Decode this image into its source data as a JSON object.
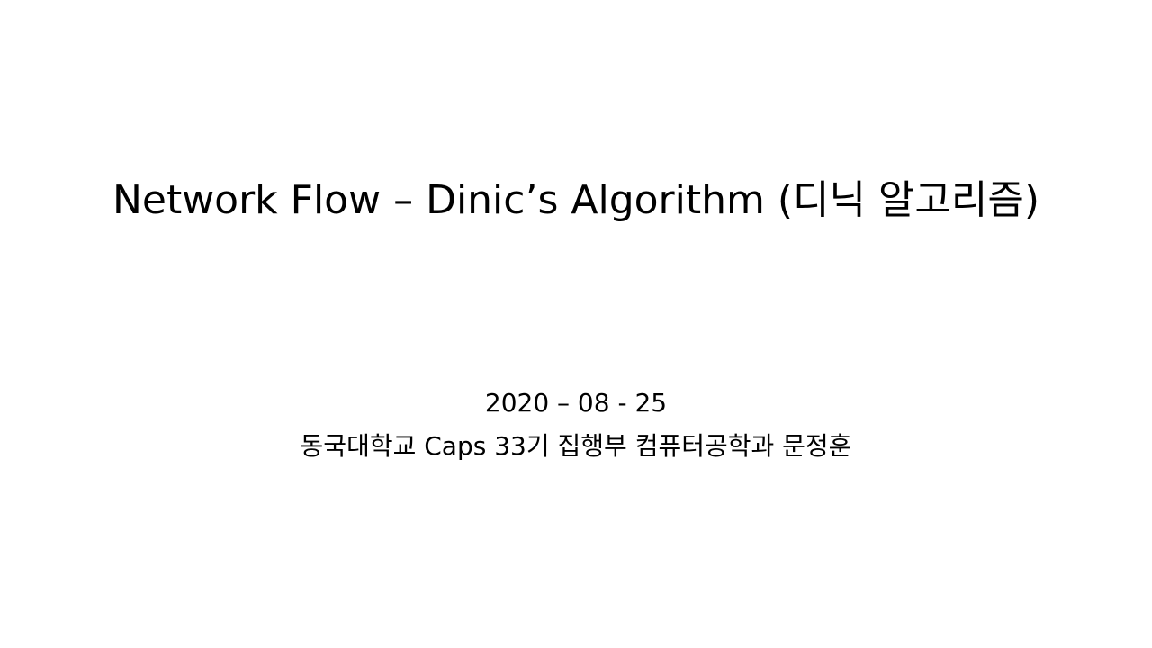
{
  "slide": {
    "title": "Network Flow – Dinic’s Algorithm (디닉 알고리즘)",
    "date": "2020 – 08 - 25",
    "author": "동국대학교 Caps 33기 집행부 컴퓨터공학과 문정훈"
  },
  "colors": {
    "background": "#ffffff",
    "text": "#000000"
  }
}
